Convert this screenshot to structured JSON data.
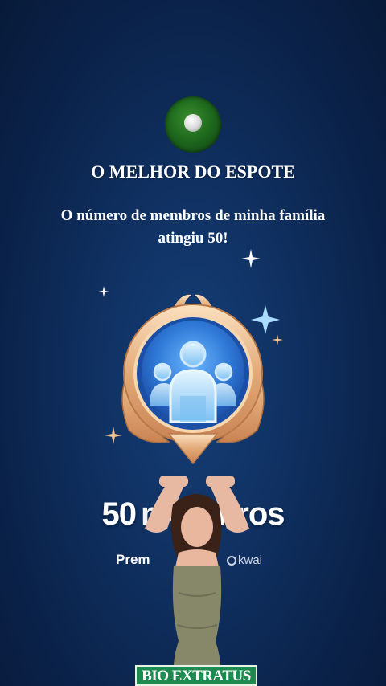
{
  "header": {
    "avatar_icon": "soccer-ball-icon",
    "title": "O MELHOR DO ESPOTE",
    "message": "O número de membros de minha família atingiu 50!"
  },
  "badge": {
    "icon": "family-members-badge-icon",
    "colors": {
      "gold": "#e7b98a",
      "blue": "#3d8fe0"
    }
  },
  "milestone": {
    "count": "50",
    "unit_fragment": "me",
    "unit_end": "bros"
  },
  "reward": {
    "label_fragment": "Prem",
    "brand": "kwai"
  },
  "overlay": {
    "sticker": "BIO EXTRATUS"
  },
  "colors": {
    "background": "#0f2f5f",
    "sticker_bg": "#1d8b4f"
  }
}
